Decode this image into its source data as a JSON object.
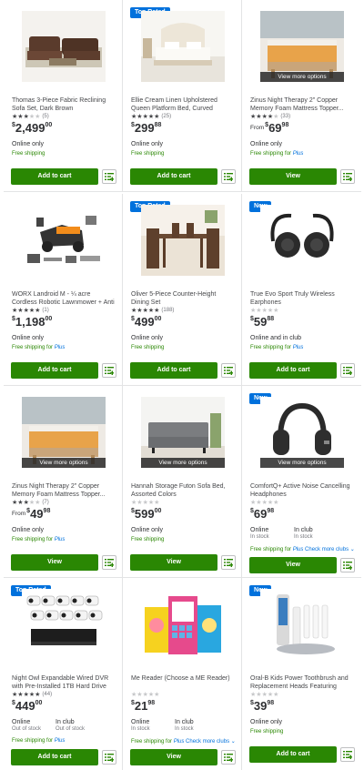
{
  "products": [
    {
      "flag": "",
      "title": "Thomas 3-Piece Fabric Reclining Sofa Set, Dark Brown",
      "stars": 2.5,
      "reviews": "(5)",
      "from": "",
      "cur": "$",
      "dollars": "2,499",
      "cents": "00",
      "avail": "Online only",
      "avail_sub": "",
      "avail2": "",
      "avail2_sub": "",
      "ship": "Free shipping",
      "ship_plus": "",
      "ship_clubs": "",
      "btn": "Add to cart",
      "vmo": "",
      "img": "sofa"
    },
    {
      "flag": "Top Rated",
      "title": "Ellie Cream Linen Upholstered Queen Platform Bed, Curved",
      "stars": 4.5,
      "reviews": "(25)",
      "from": "",
      "cur": "$",
      "dollars": "299",
      "cents": "88",
      "avail": "Online only",
      "avail_sub": "",
      "avail2": "",
      "avail2_sub": "",
      "ship": "Free shipping",
      "ship_plus": "",
      "ship_clubs": "",
      "btn": "Add to cart",
      "vmo": "",
      "img": "bed"
    },
    {
      "flag": "",
      "title": "Zinus Night Therapy 2\" Copper Memory Foam Mattress Topper...",
      "stars": 3.5,
      "reviews": "(33)",
      "from": "From",
      "cur": "$",
      "dollars": "69",
      "cents": "98",
      "avail": "Online only",
      "avail_sub": "",
      "avail2": "",
      "avail2_sub": "",
      "ship": "Free shipping for",
      "ship_plus": "Plus",
      "ship_clubs": "",
      "btn": "View",
      "vmo": "View more options",
      "img": "topper"
    },
    {
      "flag": "",
      "title": "WORX Landroid M - ¼ acre Cordless Robotic Lawnmower + Anti Collision...",
      "stars": 5,
      "reviews": "(1)",
      "from": "",
      "cur": "$",
      "dollars": "1,198",
      "cents": "00",
      "avail": "Online only",
      "avail_sub": "",
      "avail2": "",
      "avail2_sub": "",
      "ship": "Free shipping for",
      "ship_plus": "Plus",
      "ship_clubs": "",
      "btn": "Add to cart",
      "vmo": "",
      "img": "mower"
    },
    {
      "flag": "Top Rated",
      "title": "Oliver 5-Piece Counter-Height Dining Set",
      "stars": 4.5,
      "reviews": "(188)",
      "from": "",
      "cur": "$",
      "dollars": "499",
      "cents": "00",
      "avail": "Online only",
      "avail_sub": "",
      "avail2": "",
      "avail2_sub": "",
      "ship": "Free shipping",
      "ship_plus": "",
      "ship_clubs": "",
      "btn": "Add to cart",
      "vmo": "",
      "img": "dining"
    },
    {
      "flag": "New",
      "title": "True Evo Sport Truly Wireless Earphones",
      "stars": 0,
      "reviews": "",
      "from": "",
      "cur": "$",
      "dollars": "59",
      "cents": "88",
      "avail": "Online and in club",
      "avail_sub": "",
      "avail2": "",
      "avail2_sub": "",
      "ship": "Free shipping for",
      "ship_plus": "Plus",
      "ship_clubs": "",
      "btn": "Add to cart",
      "vmo": "",
      "img": "earbuds"
    },
    {
      "flag": "",
      "title": "Zinus Night Therapy 2\" Copper Memory Foam Mattress Topper...",
      "stars": 2.5,
      "reviews": "(7)",
      "from": "From",
      "cur": "$",
      "dollars": "49",
      "cents": "98",
      "avail": "Online only",
      "avail_sub": "",
      "avail2": "",
      "avail2_sub": "",
      "ship": "Free shipping for",
      "ship_plus": "Plus",
      "ship_clubs": "",
      "btn": "View",
      "vmo": "View more options",
      "img": "topper"
    },
    {
      "flag": "",
      "title": "Hannah Storage Futon Sofa Bed, Assorted Colors",
      "stars": 0,
      "reviews": "",
      "from": "",
      "cur": "$",
      "dollars": "599",
      "cents": "00",
      "avail": "Online only",
      "avail_sub": "",
      "avail2": "",
      "avail2_sub": "",
      "ship": "Free shipping",
      "ship_plus": "",
      "ship_clubs": "",
      "btn": "View",
      "vmo": "View more options",
      "img": "futon"
    },
    {
      "flag": "New",
      "title": "ComfortQ+ Active Noise Cancelling Headphones",
      "stars": 0,
      "reviews": "",
      "from": "",
      "cur": "$",
      "dollars": "69",
      "cents": "98",
      "avail": "Online",
      "avail_sub": "In stock",
      "avail2": "In club",
      "avail2_sub": "In stock",
      "ship": "Free shipping for",
      "ship_plus": "Plus",
      "ship_clubs": "Check more clubs",
      "btn": "View",
      "vmo": "View more options",
      "img": "headphones"
    },
    {
      "flag": "Top Rated",
      "title": "Night Owl Expandable Wired DVR with Pre-Installed 1TB Hard Drive and...",
      "stars": 4.5,
      "reviews": "(44)",
      "from": "",
      "cur": "$",
      "dollars": "449",
      "cents": "00",
      "avail": "Online",
      "avail_sub": "Out of stock",
      "avail2": "In club",
      "avail2_sub": "Out of stock",
      "ship": "Free shipping for",
      "ship_plus": "Plus",
      "ship_clubs": "",
      "btn": "Add to cart",
      "vmo": "",
      "img": "cameras"
    },
    {
      "flag": "",
      "title": "Me Reader (Choose a ME Reader)",
      "stars": 0,
      "reviews": "",
      "from": "",
      "cur": "$",
      "dollars": "21",
      "cents": "98",
      "avail": "Online",
      "avail_sub": "In stock",
      "avail2": "In club",
      "avail2_sub": "In stock",
      "ship": "Free shipping for",
      "ship_plus": "Plus",
      "ship_clubs": "Check more clubs",
      "btn": "View",
      "vmo": "",
      "img": "reader"
    },
    {
      "flag": "New",
      "title": "Oral-B Kids Power Toothbrush and Replacement Heads Featuring Star...",
      "stars": 0,
      "reviews": "",
      "from": "",
      "cur": "$",
      "dollars": "39",
      "cents": "98",
      "avail": "Online only",
      "avail_sub": "",
      "avail2": "",
      "avail2_sub": "",
      "ship": "Free shipping",
      "ship_plus": "",
      "ship_clubs": "",
      "btn": "Add to cart",
      "vmo": "",
      "img": "toothbrush"
    }
  ],
  "icons": {
    "list": "add-to-list-icon",
    "chevron": "chevron-down-icon"
  },
  "colors": {
    "green": "#2a8703",
    "blue": "#0071dc",
    "border": "#e3e4e5"
  }
}
